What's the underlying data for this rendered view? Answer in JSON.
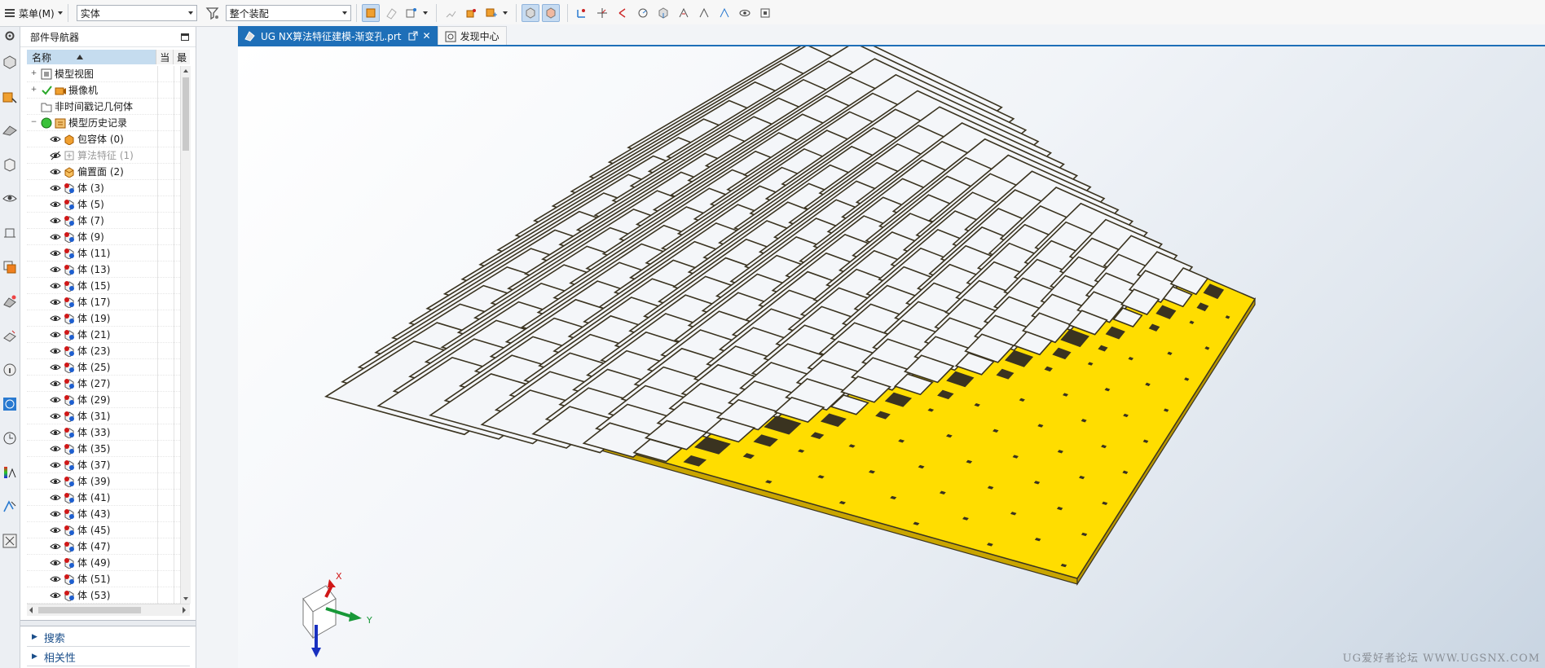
{
  "toolbar": {
    "menu_label": "菜单(M)",
    "filter_value": "实体",
    "assembly_value": "整个装配"
  },
  "navigator": {
    "title": "部件导航器",
    "columns": {
      "name": "名称",
      "current": "当",
      "latest": "最"
    },
    "tree": [
      {
        "label": "模型视图",
        "level": 0,
        "expander": "+",
        "icon": "model-views-icon"
      },
      {
        "label": "摄像机",
        "level": 0,
        "expander": "+",
        "icon": "camera-icon",
        "check": true
      },
      {
        "label": "非时间戳记几何体",
        "level": 0,
        "expander": "",
        "icon": "folder-icon"
      },
      {
        "label": "模型历史记录",
        "level": 0,
        "expander": "−",
        "icon": "history-icon",
        "status": true
      },
      {
        "label": "包容体 (0)",
        "level": 1,
        "icon": "bounding-body-icon"
      },
      {
        "label": "算法特征 (1)",
        "level": 1,
        "icon": "algorithm-feature-icon",
        "dim": true
      },
      {
        "label": "偏置面 (2)",
        "level": 1,
        "icon": "offset-face-icon"
      },
      {
        "label": "体 (3)",
        "level": 1,
        "icon": "body-icon"
      },
      {
        "label": "体 (5)",
        "level": 1,
        "icon": "body-icon"
      },
      {
        "label": "体 (7)",
        "level": 1,
        "icon": "body-icon"
      },
      {
        "label": "体 (9)",
        "level": 1,
        "icon": "body-icon"
      },
      {
        "label": "体 (11)",
        "level": 1,
        "icon": "body-icon"
      },
      {
        "label": "体 (13)",
        "level": 1,
        "icon": "body-icon"
      },
      {
        "label": "体 (15)",
        "level": 1,
        "icon": "body-icon"
      },
      {
        "label": "体 (17)",
        "level": 1,
        "icon": "body-icon"
      },
      {
        "label": "体 (19)",
        "level": 1,
        "icon": "body-icon"
      },
      {
        "label": "体 (21)",
        "level": 1,
        "icon": "body-icon"
      },
      {
        "label": "体 (23)",
        "level": 1,
        "icon": "body-icon"
      },
      {
        "label": "体 (25)",
        "level": 1,
        "icon": "body-icon"
      },
      {
        "label": "体 (27)",
        "level": 1,
        "icon": "body-icon"
      },
      {
        "label": "体 (29)",
        "level": 1,
        "icon": "body-icon"
      },
      {
        "label": "体 (31)",
        "level": 1,
        "icon": "body-icon"
      },
      {
        "label": "体 (33)",
        "level": 1,
        "icon": "body-icon"
      },
      {
        "label": "体 (35)",
        "level": 1,
        "icon": "body-icon"
      },
      {
        "label": "体 (37)",
        "level": 1,
        "icon": "body-icon"
      },
      {
        "label": "体 (39)",
        "level": 1,
        "icon": "body-icon"
      },
      {
        "label": "体 (41)",
        "level": 1,
        "icon": "body-icon"
      },
      {
        "label": "体 (43)",
        "level": 1,
        "icon": "body-icon"
      },
      {
        "label": "体 (45)",
        "level": 1,
        "icon": "body-icon"
      },
      {
        "label": "体 (47)",
        "level": 1,
        "icon": "body-icon"
      },
      {
        "label": "体 (49)",
        "level": 1,
        "icon": "body-icon"
      },
      {
        "label": "体 (51)",
        "level": 1,
        "icon": "body-icon"
      },
      {
        "label": "体 (53)",
        "level": 1,
        "icon": "body-icon"
      }
    ],
    "panels": {
      "search": "搜索",
      "relations": "相关性"
    }
  },
  "tabs": [
    {
      "label": "UG NX算法特征建模-渐变孔.prt",
      "active": true
    },
    {
      "label": "发现中心",
      "active": false
    }
  ],
  "viewport": {
    "triad": {
      "x": "X",
      "y": "Y"
    },
    "watermark": "UG爱好者论坛 WWW.UGSNX.COM",
    "colors": {
      "plate": "#FFDD00",
      "edge": "#3a3320"
    }
  }
}
